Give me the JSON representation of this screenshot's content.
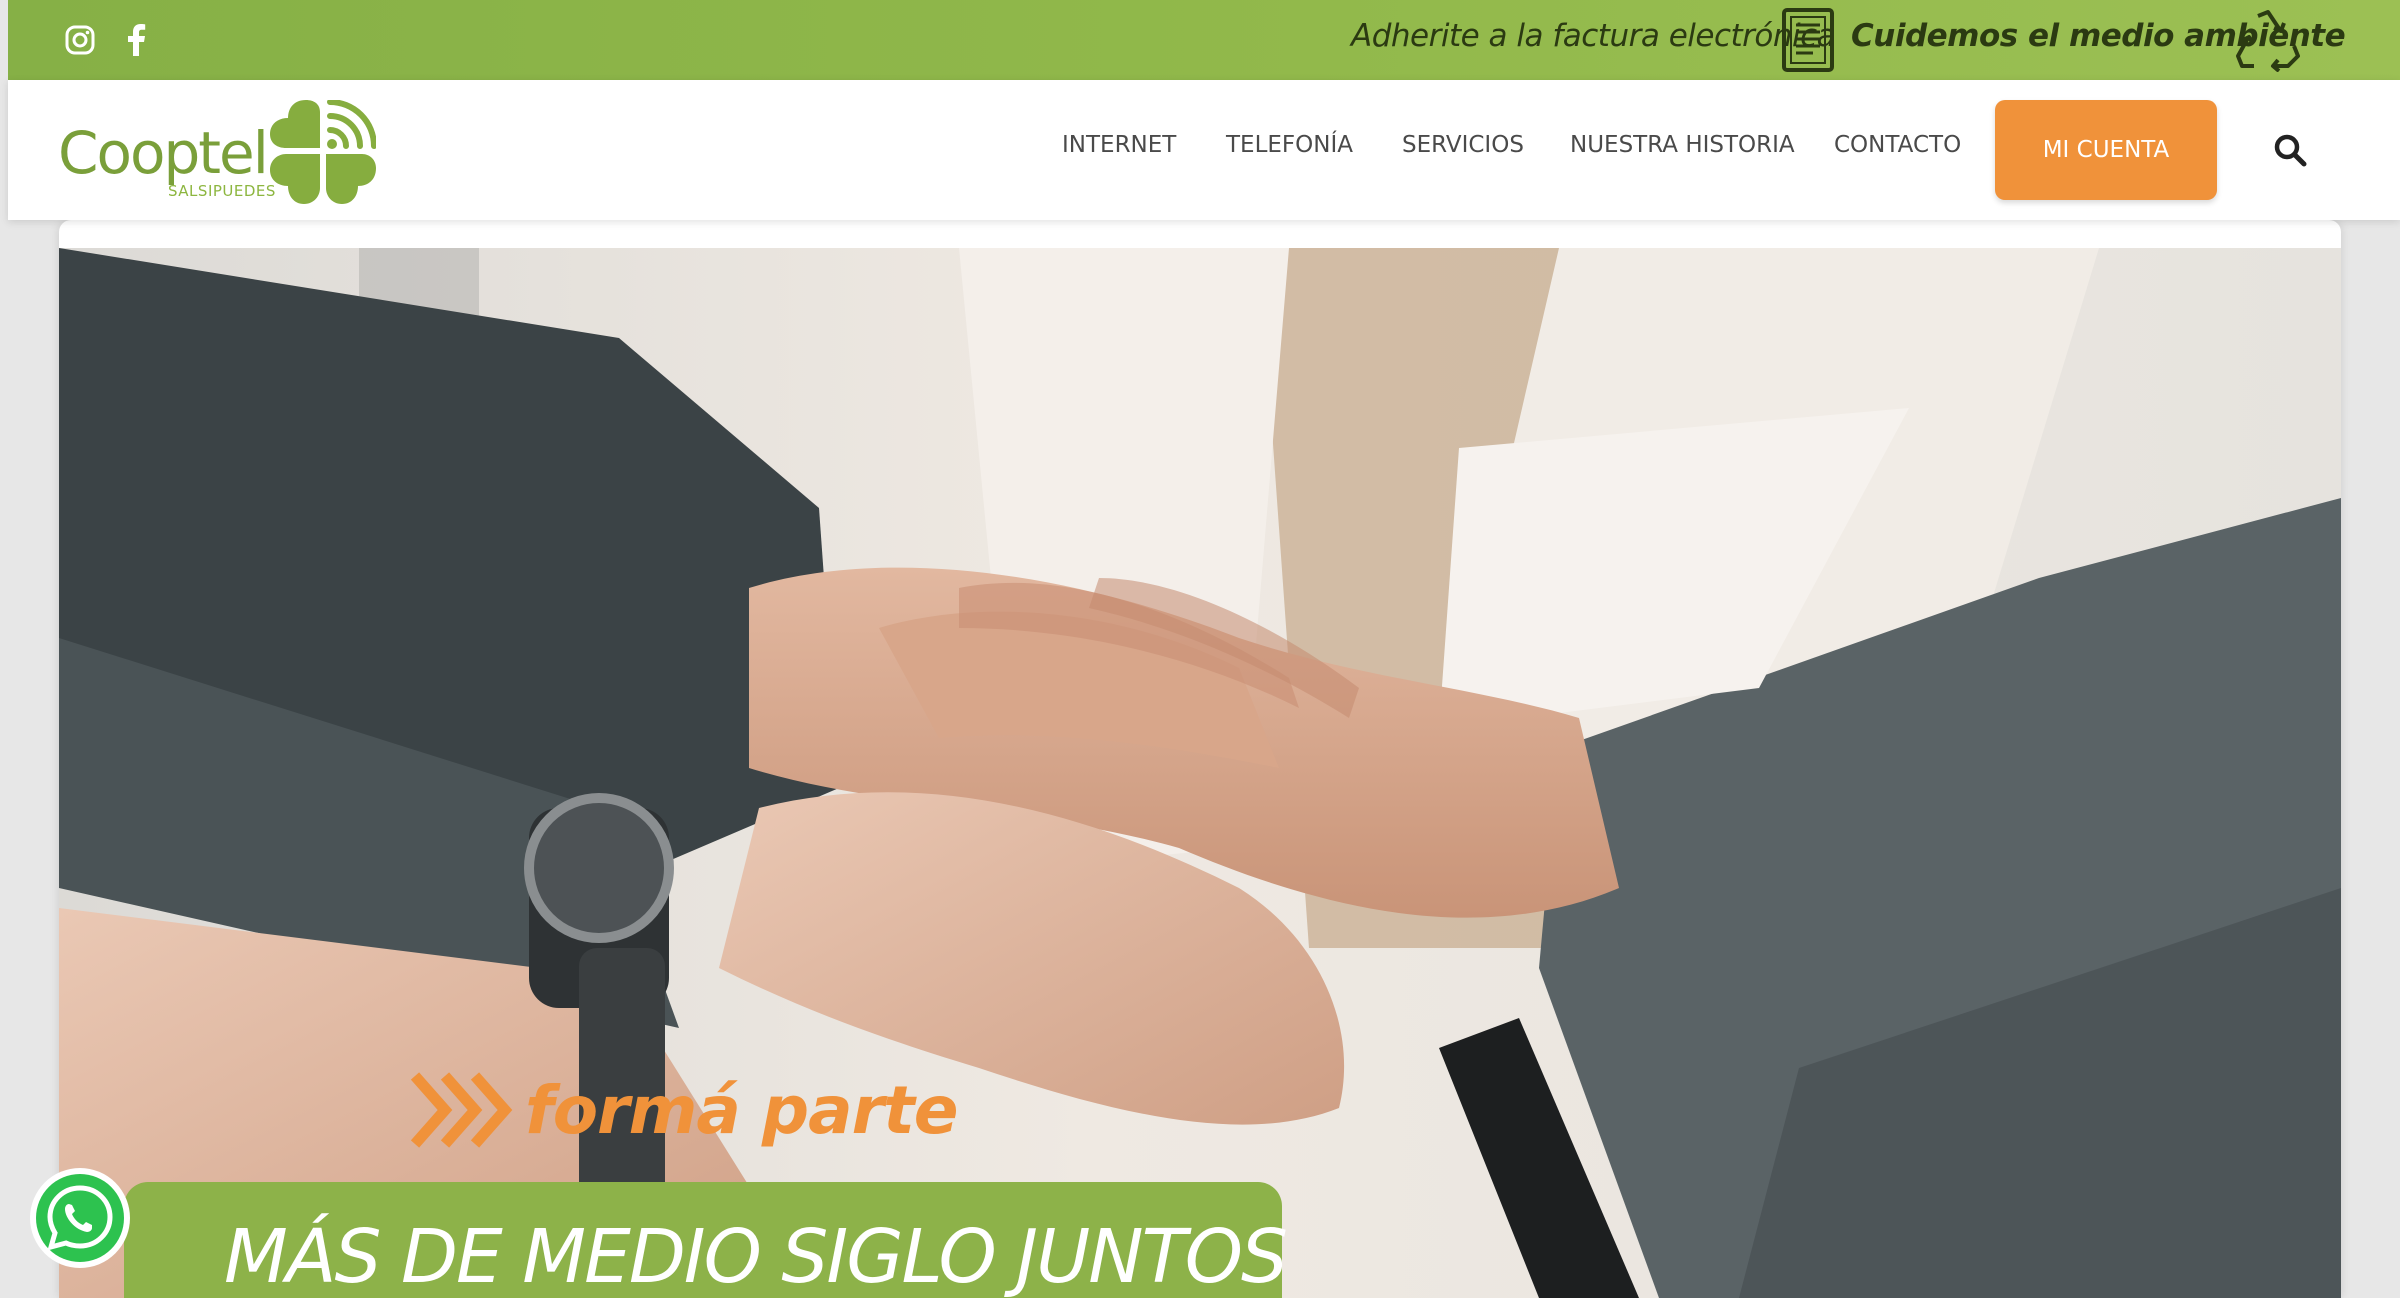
{
  "topbar": {
    "social": {
      "instagram_icon": "instagram-icon",
      "facebook_icon": "facebook-icon"
    },
    "promo_1": "Adherite a la factura electrónica",
    "promo_2": "Cuidemos el medio ambiente",
    "icons": {
      "doc": "document-icon",
      "recycle": "recycle-icon"
    }
  },
  "header": {
    "logo": {
      "name": "Cooptel",
      "sub": "SALSIPUEDES"
    },
    "nav": [
      "INTERNET",
      "TELEFONÍA",
      "SERVICIOS",
      "NUESTRA HISTORIA",
      "CONTACTO"
    ],
    "cta": "MI CUENTA",
    "search_icon": "search-icon"
  },
  "hero": {
    "tagline": "formá parte",
    "banner": "MÁS DE MEDIO SIGLO JUNTOS"
  },
  "whatsapp_icon": "whatsapp-icon",
  "colors": {
    "brand_green": "#8db249",
    "accent_orange": "#f0923a",
    "nav_text": "#4a4a4a"
  }
}
